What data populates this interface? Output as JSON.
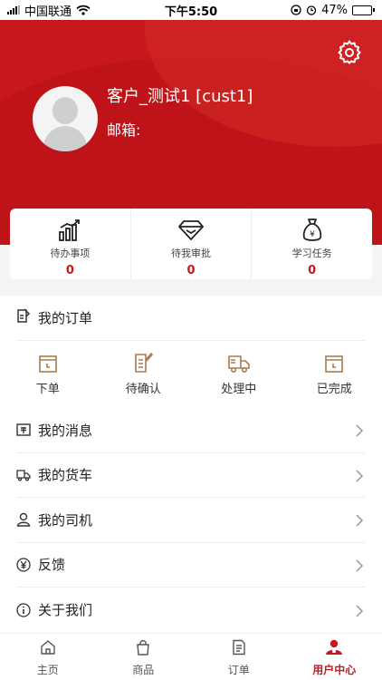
{
  "status_bar": {
    "carrier": "中国联通",
    "time": "下午5:50",
    "battery": "47%",
    "battery_level": 0.47
  },
  "profile": {
    "name": "客户_测试1 [cust1]",
    "email_label": "邮箱:",
    "email_value": ""
  },
  "stats": [
    {
      "label": "待办事项",
      "value": "0",
      "icon": "bar-chart-icon"
    },
    {
      "label": "待我审批",
      "value": "0",
      "icon": "diamond-icon"
    },
    {
      "label": "学习任务",
      "value": "0",
      "icon": "money-bag-icon"
    }
  ],
  "orders": {
    "title": "我的订单",
    "states": [
      {
        "label": "下单",
        "icon": "calendar-icon"
      },
      {
        "label": "待确认",
        "icon": "edit-doc-icon"
      },
      {
        "label": "处理中",
        "icon": "truck-icon"
      },
      {
        "label": "已完成",
        "icon": "calendar-icon"
      }
    ]
  },
  "menu": [
    {
      "label": "我的消息",
      "icon": "message-icon"
    },
    {
      "label": "我的货车",
      "icon": "truck-icon"
    },
    {
      "label": "我的司机",
      "icon": "user-icon"
    },
    {
      "label": "反馈",
      "icon": "yen-circle-icon"
    },
    {
      "label": "关于我们",
      "icon": "info-icon"
    }
  ],
  "tabs": [
    {
      "label": "主页",
      "icon": "home-icon"
    },
    {
      "label": "商品",
      "icon": "shopping-bag-icon"
    },
    {
      "label": "订单",
      "icon": "order-doc-icon"
    },
    {
      "label": "用户中心",
      "icon": "user-center-icon",
      "active": true
    }
  ],
  "colors": {
    "brand_red": "#c8171d",
    "accent_brown": "#a87c4f",
    "background": "#f4f4f4"
  }
}
